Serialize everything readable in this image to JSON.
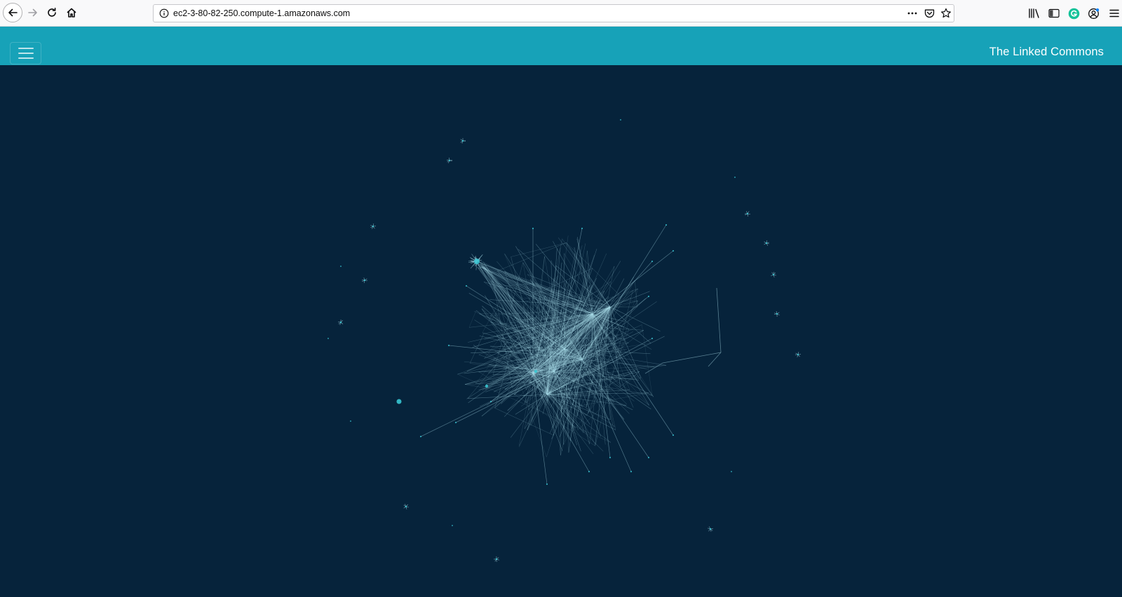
{
  "browser": {
    "url": "ec2-3-80-82-250.compute-1.amazonaws.com",
    "icons": [
      "back-arrow-icon",
      "forward-arrow-icon",
      "reload-icon",
      "home-icon",
      "info-icon",
      "more-dots-icon",
      "pocket-icon",
      "bookmark-star-icon",
      "library-icon",
      "sidebar-icon",
      "grammarly-icon",
      "account-icon",
      "hamburger-menu-icon"
    ]
  },
  "header": {
    "title": "The Linked Commons",
    "background_color": "#17a2b8"
  },
  "graph": {
    "background_color": "#06233b",
    "edge_color": "#a9dce8",
    "node_color": "#37c6d3"
  }
}
